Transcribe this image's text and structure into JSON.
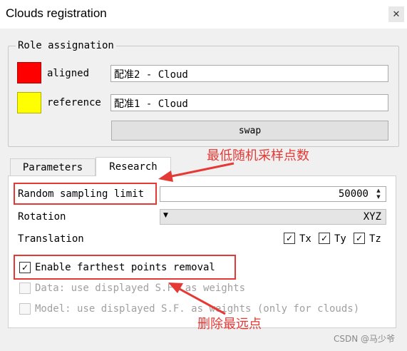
{
  "window": {
    "title": "Clouds registration",
    "close_glyph": "✕"
  },
  "role_assignation": {
    "title": "Role assignation",
    "aligned": {
      "label": "aligned",
      "value": "配准2 - Cloud",
      "color": "#ff0000"
    },
    "reference": {
      "label": "reference",
      "value": "配准1 - Cloud",
      "color": "#ffff00"
    },
    "swap_label": "swap"
  },
  "tabs": [
    {
      "label": "Parameters",
      "active": false
    },
    {
      "label": "Research",
      "active": true
    }
  ],
  "research": {
    "random_sampling_limit": {
      "label": "Random sampling limit",
      "value": "50000"
    },
    "rotation": {
      "label": "Rotation",
      "value": "XYZ"
    },
    "translation": {
      "label": "Translation",
      "tx": {
        "label": "Tx",
        "checked": true
      },
      "ty": {
        "label": "Ty",
        "checked": true
      },
      "tz": {
        "label": "Tz",
        "checked": true
      }
    },
    "farthest_removal": {
      "label": "Enable farthest points removal",
      "checked": true
    },
    "data_weights": {
      "label": "Data: use displayed S.F. as weights",
      "checked": false,
      "enabled": false
    },
    "model_weights": {
      "label": "Model: use displayed S.F. as weights (only for clouds)",
      "checked": false,
      "enabled": false
    }
  },
  "annotations": {
    "sampling_note": "最低随机采样点数",
    "removal_note": "删除最远点",
    "color": "#e53935"
  },
  "watermark": "CSDN @马少爷",
  "check_glyph": "✓",
  "icons": {
    "close": "close-icon",
    "spin_up": "chevron-up-icon",
    "spin_down": "chevron-down-icon",
    "combo": "dropdown-arrow-icon"
  }
}
